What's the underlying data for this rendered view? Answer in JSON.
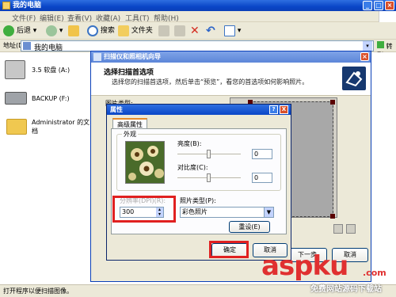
{
  "explorer": {
    "title": "我的电脑",
    "menu": [
      "文件(F)",
      "编辑(E)",
      "查看(V)",
      "收藏(A)",
      "工具(T)",
      "帮助(H)"
    ],
    "toolbar": {
      "back": "后退",
      "search": "搜索",
      "folders": "文件夹"
    },
    "address": {
      "label": "地址(D)",
      "value": "我的电脑",
      "go": "转到"
    },
    "drives": [
      {
        "label": "3.5 软盘 (A:)"
      },
      {
        "label": "BACKUP (F:)"
      },
      {
        "label": "Administrator 的文档"
      }
    ],
    "status": "打开程序以便扫描图像。"
  },
  "wizard": {
    "title": "扫描仪和照相机向导",
    "heading": "选择扫描首选项",
    "subheading": "选择您的扫描首选项，然后单击“预览”，看您的首选项如何影响照片。",
    "picture_type_label": "图片类型:",
    "next_button": "下一步",
    "cancel_button": "取消"
  },
  "properties": {
    "title": "属性",
    "help": "?",
    "close": "X",
    "tab": "高级属性",
    "appearance_label": "外观",
    "brightness_label": "亮度(B):",
    "brightness_value": "0",
    "contrast_label": "对比度(C):",
    "contrast_value": "0",
    "resolution_label": "分辨率(DPI)(R):",
    "resolution_value": "300",
    "picture_type_label": "照片类型(P):",
    "picture_type_value": "彩色照片",
    "reset_button": "重设(E)",
    "ok_button": "确定",
    "cancel_button": "取消",
    "brightness_level": 0.5,
    "contrast_level": 0.5
  },
  "watermark": {
    "brand": "aspku",
    "suffix": ".com",
    "tagline": "免费网站源码下载站"
  }
}
